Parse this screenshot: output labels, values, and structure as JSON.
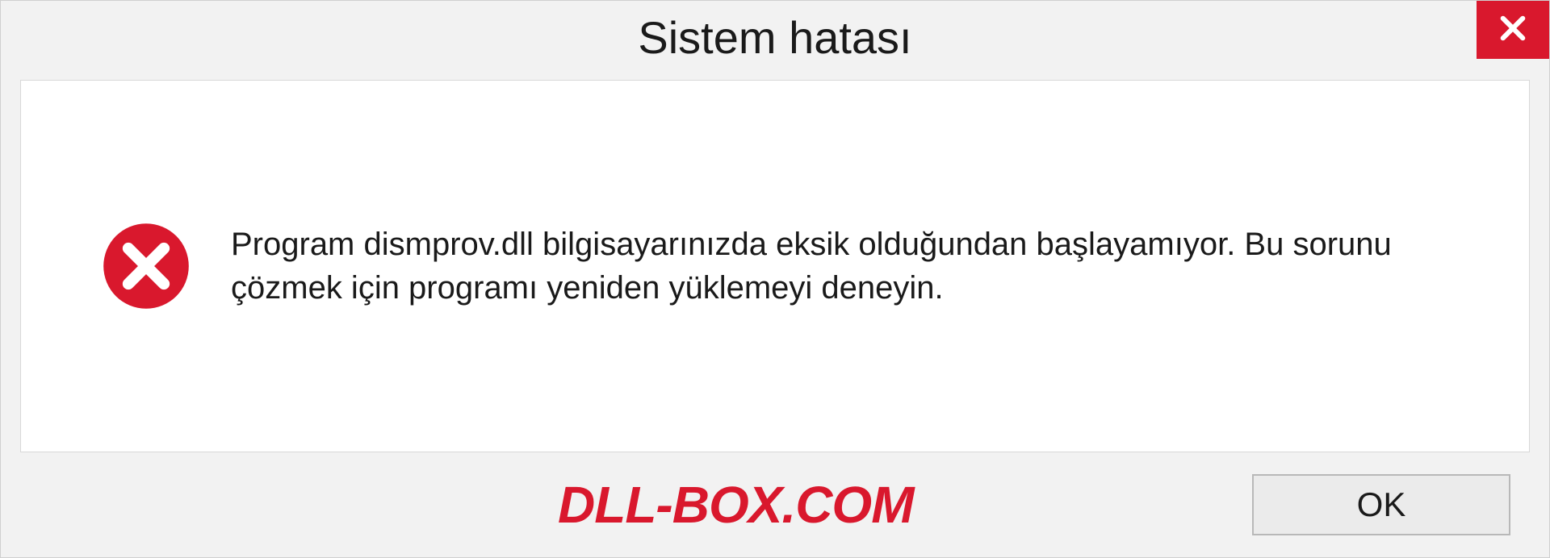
{
  "dialog": {
    "title": "Sistem hatası",
    "message": "Program dismprov.dll bilgisayarınızda eksik olduğundan başlayamıyor. Bu sorunu çözmek için programı yeniden yüklemeyi deneyin.",
    "ok_label": "OK"
  },
  "watermark": "DLL-BOX.COM",
  "colors": {
    "accent_red": "#d9182d",
    "background": "#f2f2f2",
    "content_bg": "#ffffff"
  }
}
